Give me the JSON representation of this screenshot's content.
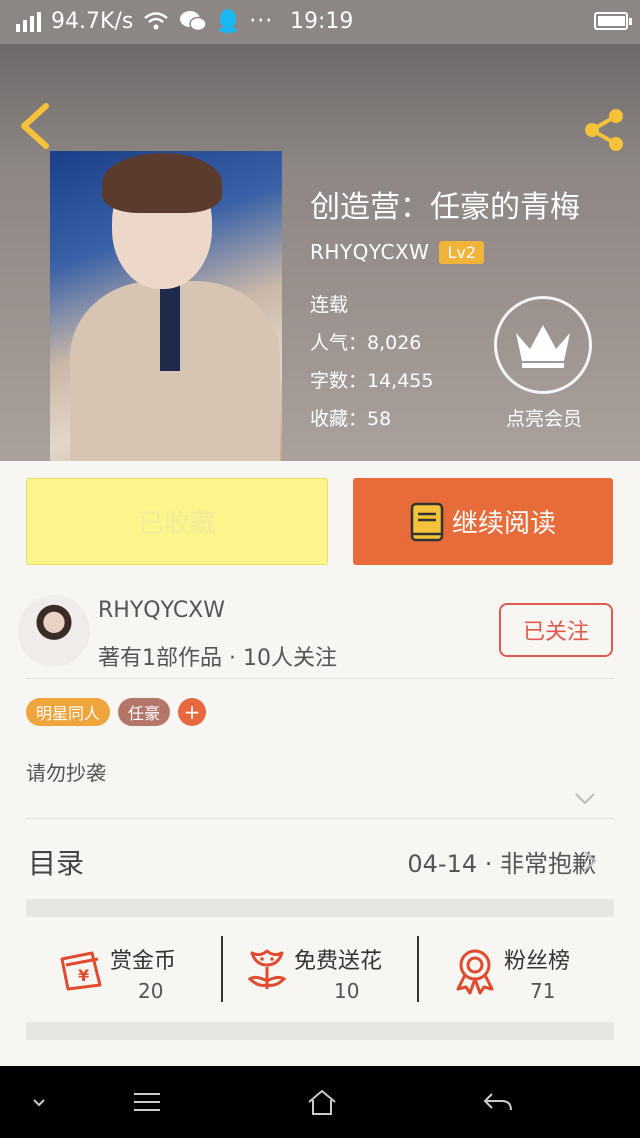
{
  "status_bar": {
    "speed": "94.7K/s",
    "time": "19:19"
  },
  "book": {
    "title": "创造营：任豪的青梅",
    "author": "RHYQYCXW",
    "level": "Lv2",
    "status": "连载",
    "popularity": "人气：8,026",
    "word_count": "字数：14,455",
    "favorites": "收藏：58",
    "vip_label": "点亮会员"
  },
  "actions": {
    "collected_label": "已收藏",
    "read_label": "继续阅读"
  },
  "author_card": {
    "name": "RHYQYCXW",
    "stats": "著有1部作品 · 10人关注",
    "follow_label": "已关注"
  },
  "tags": [
    {
      "label": "明星同人",
      "color": "#f0a43c"
    },
    {
      "label": "任豪",
      "color": "#b5766a"
    }
  ],
  "tag_add_label": "+",
  "description": "请勿抄袭",
  "toc": {
    "title": "目录",
    "latest": "04-14 · 非常抱歉"
  },
  "stats": [
    {
      "label": "赏金币",
      "value": "20",
      "icon": "red-envelope-icon"
    },
    {
      "label": "免费送花",
      "value": "10",
      "icon": "flower-icon"
    },
    {
      "label": "粉丝榜",
      "value": "71",
      "icon": "award-ribbon-icon"
    }
  ],
  "colors": {
    "accent": "#e86b3a",
    "collected_bg": "#fbf58c",
    "stat_icon": "#e04a2f",
    "follow": "#e05a4e"
  }
}
